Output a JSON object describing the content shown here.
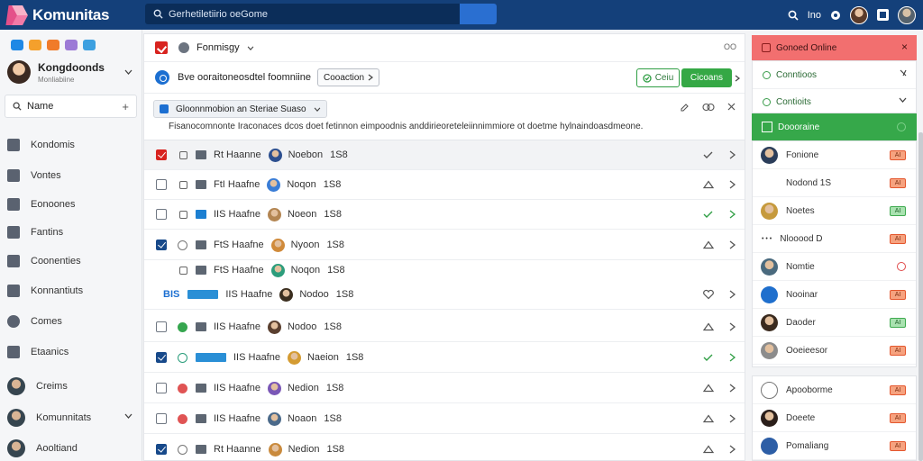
{
  "app": {
    "title": "Komunitas"
  },
  "search": {
    "value": "Gerhetiletiirio oeGome",
    "placeholder": ""
  },
  "sidebar": {
    "account": {
      "name": "Kongdoonds",
      "sub": "Monliabiine"
    },
    "new_label": "Name",
    "new_plus": "+",
    "app_colors": [
      "#1e88e5",
      "#f4a02c",
      "#f07b2a",
      "#9c7ad6",
      "#3da0e0"
    ],
    "items": [
      {
        "label": "Kondomis",
        "icon": "gallery-icon"
      },
      {
        "label": "Vontes",
        "icon": "folder-icon"
      },
      {
        "label": "Eonoones",
        "icon": "window-icon"
      },
      {
        "label": "Fantins",
        "icon": "check-square-icon"
      },
      {
        "label": "Coonenties",
        "icon": "note-icon"
      },
      {
        "label": "Konnantiuts",
        "icon": "document-icon"
      },
      {
        "label": "Comes",
        "icon": "clock-icon"
      },
      {
        "label": "Etaanics",
        "icon": "stack-icon"
      },
      {
        "label": "Creims",
        "icon": "avatar-icon"
      },
      {
        "label": "Komunnitats",
        "icon": "avatar-icon"
      },
      {
        "label": "Aooltiand",
        "icon": "avatar-icon"
      }
    ]
  },
  "top_right": {
    "label": "Ino"
  },
  "main": {
    "crumb": "Fonmisgy",
    "header_icon": "OO",
    "bar": {
      "text": "Bve ooraitoneosdtel foomniine",
      "dropdown": "Cooaction",
      "btn_outline": "Ceiu",
      "btn_primary": "Cicoans"
    },
    "filter": {
      "chip": "Gloonnmobion an Steriae Suaso",
      "description": "Fisanocomnonte Iraconaces dcos doet fetinnon eimpoodnis anddirieoreteleiinnimmiore ot doetme hylnaindoasdmeone."
    },
    "rows": [
      {
        "checkbox": "red",
        "dot": "lock",
        "tag": "Rt Haanne",
        "name": "Noebon",
        "num": "1S8",
        "action": "check",
        "av": "#2c4f8f",
        "shaded": true
      },
      {
        "checkbox": "off",
        "dot": "lock",
        "tag": "FtI Haafne",
        "name": "Noqon",
        "num": "1S8",
        "action": "triangle",
        "av": "#3a7dd6"
      },
      {
        "checkbox": "off",
        "dot": "lock",
        "tag": "IIS Haafne",
        "name": "Noeon",
        "num": "1S8",
        "action": "check-green",
        "av": "#b38552",
        "tagBlue": true
      },
      {
        "checkbox": "on",
        "dot": "ring",
        "tag": "FtS Haafne",
        "name": "Nyoon",
        "num": "1S8",
        "action": "triangle",
        "av": "#d08a3a"
      },
      {
        "checkbox": "none",
        "dot": "lock",
        "tag": "FtS Haafne",
        "name": "Noqon",
        "num": "1S8",
        "action": "none",
        "av": "#2d9d7c",
        "thin": true
      },
      {
        "checkbox": "none",
        "dot": "none",
        "tag": "IIS Haafne",
        "name": "Nodoo",
        "num": "1S8",
        "action": "heart",
        "av": "#3b2e1f",
        "wideTag": true,
        "lead": "BIS"
      },
      {
        "checkbox": "off",
        "dot": "green",
        "tag": "IIS Haafne",
        "name": "Nodoo",
        "num": "1S8",
        "action": "triangle",
        "av": "#5a3f2f"
      },
      {
        "checkbox": "on",
        "dot": "teal",
        "tag": "IIS Haafne",
        "name": "Naeion",
        "num": "1S8",
        "action": "check-green",
        "av": "#d49b32",
        "wideTag": true
      },
      {
        "checkbox": "off",
        "dot": "red",
        "tag": "IIS Haafne",
        "name": "Nedion",
        "num": "1S8",
        "action": "triangle",
        "av": "#7a57b6"
      },
      {
        "checkbox": "off",
        "dot": "red",
        "tag": "IIS Haafne",
        "name": "Noaon",
        "num": "1S8",
        "action": "triangle",
        "av": "#4b6a8a"
      },
      {
        "checkbox": "on",
        "dot": "ring",
        "tag": "Rt Haanne",
        "name": "Nedion",
        "num": "1S8",
        "action": "triangle",
        "av": "#c98a3d"
      }
    ]
  },
  "rpanel": {
    "header": "Gonoed Online",
    "close": "×",
    "sel1": "Conntioos",
    "sel2": "Contioits",
    "active": "Doooraine",
    "people": [
      {
        "name": "Fonione",
        "badge": "orange",
        "badgeText": "AI",
        "av": "#2b3d5a"
      },
      {
        "name": "Nodond 1S",
        "badge": "orange",
        "badgeText": "AI",
        "av": ""
      },
      {
        "name": "Noetes",
        "badge": "green",
        "badgeText": "AI",
        "av": "#c69a3c"
      },
      {
        "name": "Nlooood D",
        "badge": "orange",
        "badgeText": "AI",
        "av": "",
        "prefix": "• • •"
      },
      {
        "name": "Nomtie",
        "badge": "ring",
        "badgeText": "",
        "av": "#4a6a7e"
      },
      {
        "name": "Nooinar",
        "badge": "orange",
        "badgeText": "AI",
        "av": "#1f6fcd"
      },
      {
        "name": "Daoder",
        "badge": "green",
        "badgeText": "AI",
        "av": "#3a2a1e"
      },
      {
        "name": "Ooeieesor",
        "badge": "orange",
        "badgeText": "AI",
        "av": "#8c8c8c"
      },
      {
        "name": "Apooborme",
        "badge": "orange",
        "badgeText": "AI",
        "av": "ring"
      },
      {
        "name": "Doeete",
        "badge": "orange",
        "badgeText": "AI",
        "av": "#2a1e1a"
      },
      {
        "name": "Pomaliang",
        "badge": "orange",
        "badgeText": "AI",
        "av": "#2d5ea6"
      }
    ]
  }
}
